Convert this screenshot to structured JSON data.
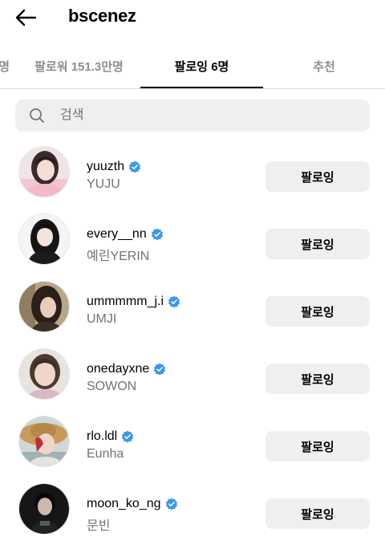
{
  "header": {
    "title": "bscenez"
  },
  "tabs": [
    {
      "label": "팔로우명",
      "display": "명"
    },
    {
      "label": "팔로워 151.3만명"
    },
    {
      "label": "팔로잉 6명",
      "active": true
    },
    {
      "label": "추천"
    }
  ],
  "search": {
    "placeholder": "검색"
  },
  "users": [
    {
      "username": "yuuzth",
      "full_name": "YUJU",
      "button": "팔로잉",
      "verified": true
    },
    {
      "username": "every__nn",
      "full_name": "예린YERIN",
      "button": "팔로잉",
      "verified": true
    },
    {
      "username": "ummmmm_j.i",
      "full_name": "UMJI",
      "button": "팔로잉",
      "verified": true
    },
    {
      "username": "onedayxne",
      "full_name": "SOWON",
      "button": "팔로잉",
      "verified": true
    },
    {
      "username": "rlo.ldl",
      "full_name": "Eunha",
      "button": "팔로잉",
      "verified": true
    },
    {
      "username": "moon_ko_ng",
      "full_name": "문빈",
      "button": "팔로잉",
      "verified": true
    }
  ],
  "colors": {
    "verified_blue": "#3897f0",
    "button_bg": "#efefef",
    "secondary_text": "#737373",
    "inactive_tab": "#8e8e8e"
  }
}
